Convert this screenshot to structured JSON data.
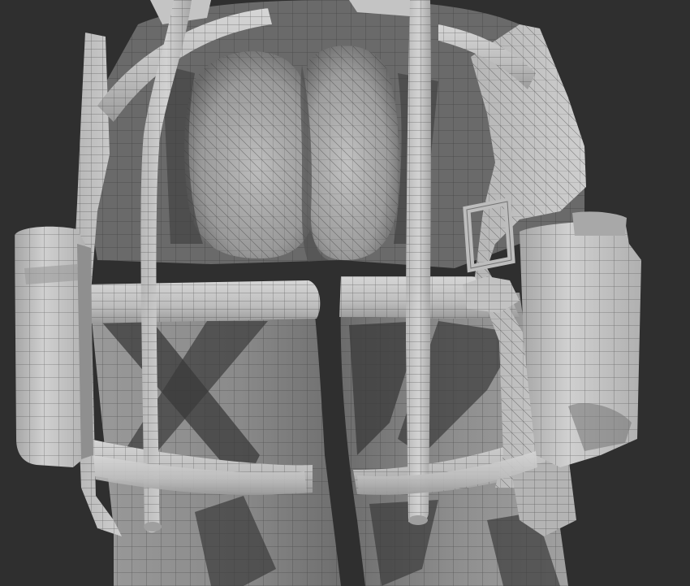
{
  "viewport": {
    "background": "#2f2f2f",
    "mesh_base": "#8c8c8c",
    "mesh_light": "#c9c9c9",
    "mesh_shadow": "#474747",
    "wire": "#2a2a2a",
    "objects": [
      "hips",
      "left-thigh",
      "right-thigh",
      "left-strap",
      "right-strap",
      "upper-belt",
      "lower-belt",
      "left-pouch",
      "right-pouch",
      "right-belt-loop",
      "right-buckle"
    ]
  }
}
